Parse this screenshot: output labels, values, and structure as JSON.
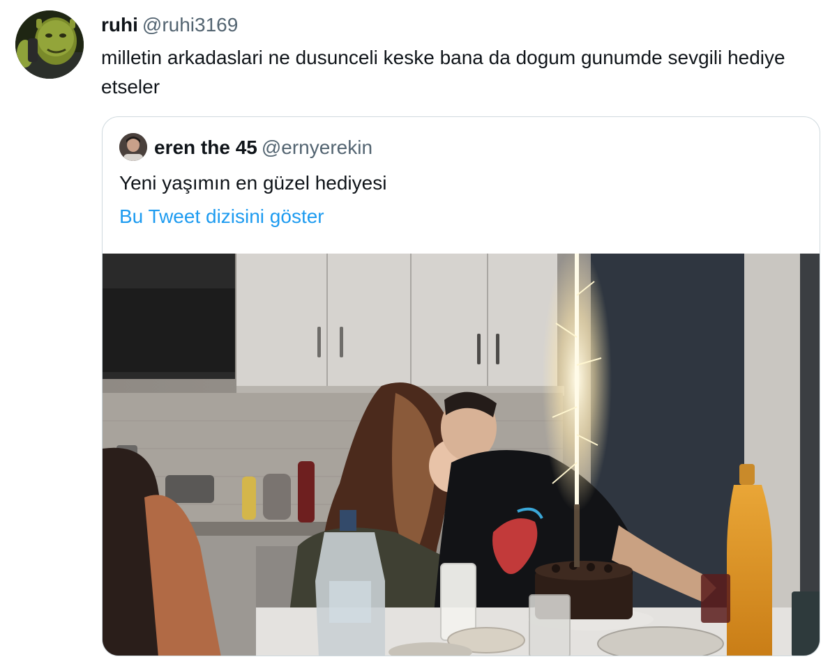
{
  "tweet": {
    "author": {
      "display_name": "ruhi",
      "handle": "@ruhi3169"
    },
    "text": "milletin arkadaslari ne dusunceli keske bana da dogum gunumde sevgili hediye etseler"
  },
  "quoted_tweet": {
    "author": {
      "display_name": "eren the 45",
      "handle": "@ernyerekin"
    },
    "text": "Yeni yaşımın en güzel hediyesi",
    "thread_link": "Bu Tweet dizisini göster"
  },
  "colors": {
    "primary_text": "#0f1419",
    "secondary_text": "#536471",
    "link": "#1d9bf0",
    "card_border": "#cfd9de"
  }
}
